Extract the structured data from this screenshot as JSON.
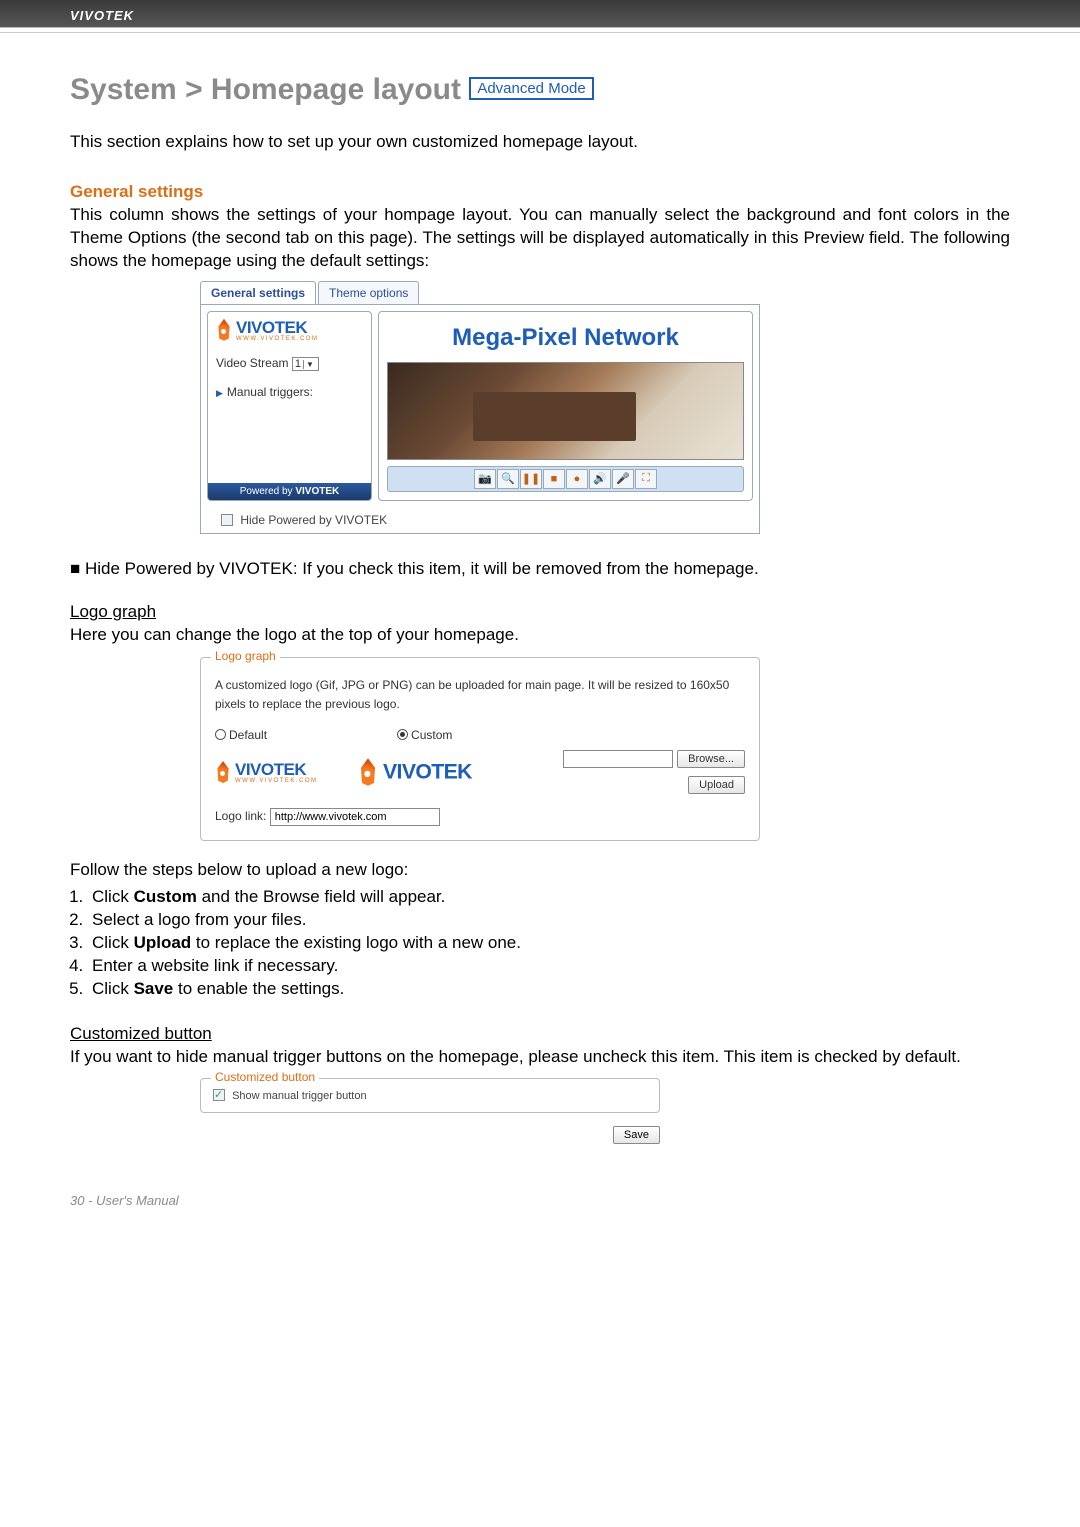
{
  "header": {
    "brand": "VIVOTEK"
  },
  "title": {
    "breadcrumb": "System > Homepage layout",
    "badge": "Advanced Mode"
  },
  "intro": "This section explains how to set up your own customized homepage layout.",
  "general": {
    "heading": "General settings",
    "text": "This column shows the settings of your hompage layout. You can manually select the background and font colors in the Theme Options (the second tab on this page). The settings will be displayed automatically in this Preview field. The following shows the homepage using the default settings:"
  },
  "preview": {
    "tabs": {
      "a": "General settings",
      "b": "Theme options"
    },
    "banner": "Mega-Pixel Network",
    "video_stream_label": "Video Stream",
    "video_stream_value": "1",
    "manual_triggers": "Manual triggers:",
    "powered_prefix": "Powered by",
    "powered_logo": "VIVOTEK",
    "hide_label": "Hide Powered by VIVOTEK"
  },
  "hide_note": "■ Hide Powered by VIVOTEK: If you check this item, it will be removed from the homepage.",
  "logo": {
    "heading": "Logo graph",
    "intro": "Here you can change the logo at the top of your homepage.",
    "legend": "Logo graph",
    "desc": "A customized logo (Gif, JPG or PNG) can be uploaded for main page. It will be resized to 160x50 pixels to replace the previous logo.",
    "opt_default": "Default",
    "opt_custom": "Custom",
    "browse": "Browse...",
    "upload": "Upload",
    "logo_link_label": "Logo link:",
    "logo_link_value": "http://www.vivotek.com"
  },
  "steps": {
    "intro": "Follow the steps below to upload a new logo:",
    "s1a": "Click ",
    "s1b": "Custom",
    "s1c": " and the Browse field will appear.",
    "s2": "Select a logo from your files.",
    "s3a": "Click ",
    "s3b": "Upload",
    "s3c": " to replace the existing logo with a new one.",
    "s4": "Enter a website link if necessary.",
    "s5a": "Click ",
    "s5b": "Save",
    "s5c": " to enable the settings."
  },
  "custbtn": {
    "heading": "Customized button",
    "text": "If you want to hide manual trigger buttons on the homepage, please uncheck this item. This item is checked by default.",
    "legend": "Customized button",
    "checkbox_label": "Show manual trigger button",
    "save": "Save"
  },
  "footer": "30 - User's Manual",
  "logo_text": {
    "main": "VIVOTEK",
    "sub": "WWW.VIVOTEK.COM"
  }
}
